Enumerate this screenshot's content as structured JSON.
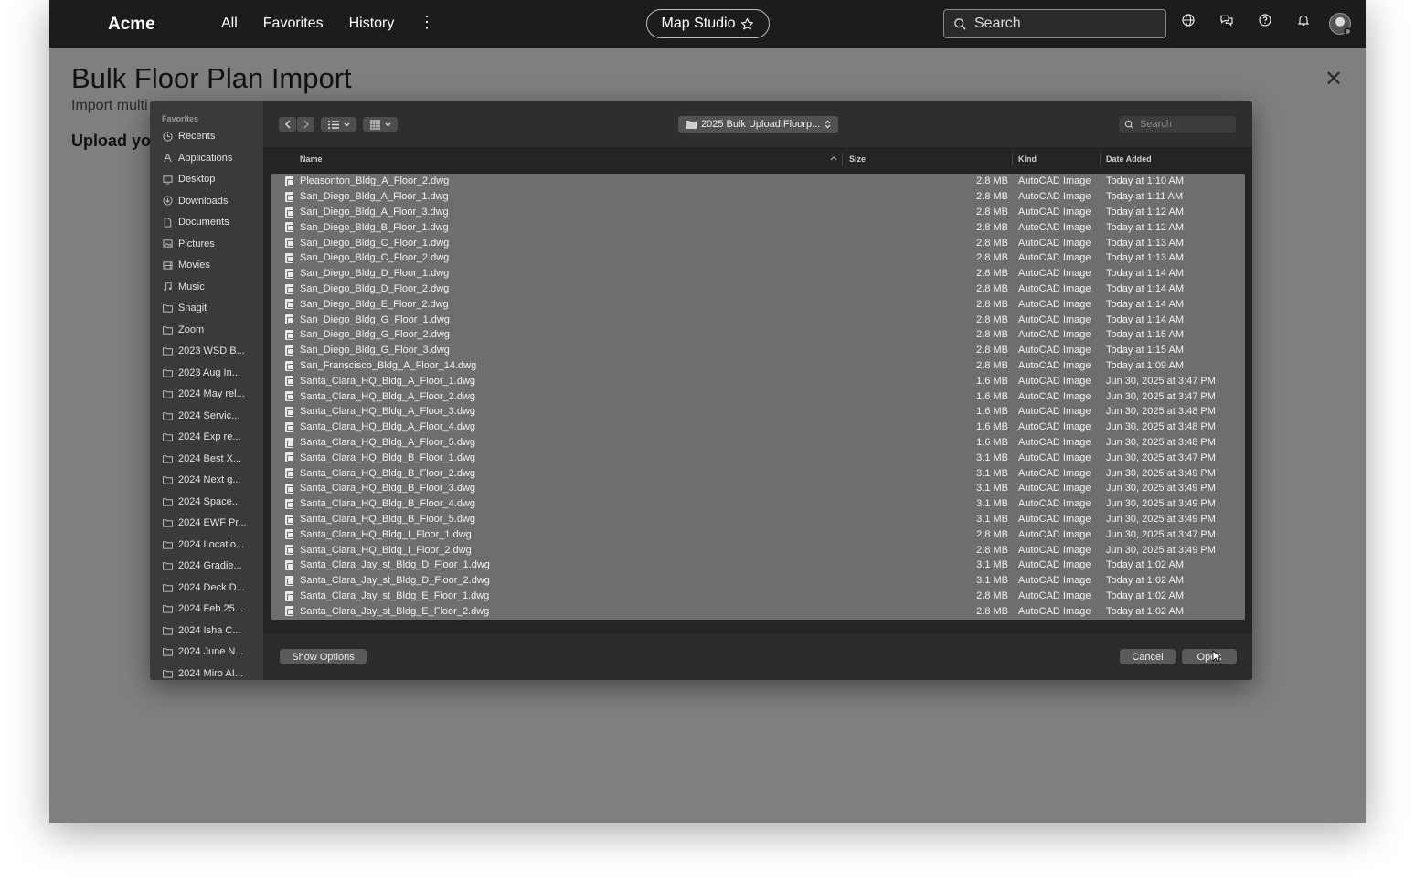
{
  "topnav": {
    "brand": "Acme",
    "links": [
      "All",
      "Favorites",
      "History"
    ],
    "workspace": "Map Studio",
    "search_placeholder": "Search"
  },
  "page": {
    "title": "Bulk Floor Plan Import",
    "subtitle": "Import multi",
    "upload_label": "Upload you"
  },
  "dialog": {
    "sidebar_section": "Favorites",
    "sidebar_items": [
      {
        "label": "Recents",
        "icon": "clock-icon"
      },
      {
        "label": "Applications",
        "icon": "applications-icon"
      },
      {
        "label": "Desktop",
        "icon": "desktop-icon"
      },
      {
        "label": "Downloads",
        "icon": "download-icon"
      },
      {
        "label": "Documents",
        "icon": "document-icon"
      },
      {
        "label": "Pictures",
        "icon": "picture-icon"
      },
      {
        "label": "Movies",
        "icon": "film-icon"
      },
      {
        "label": "Music",
        "icon": "music-icon"
      },
      {
        "label": "Snagit",
        "icon": "folder-icon"
      },
      {
        "label": "Zoom",
        "icon": "folder-icon"
      },
      {
        "label": "2023 WSD B...",
        "icon": "folder-icon"
      },
      {
        "label": "2023 Aug In...",
        "icon": "folder-icon"
      },
      {
        "label": "2024 May rel...",
        "icon": "folder-icon"
      },
      {
        "label": "2024 Servic...",
        "icon": "folder-icon"
      },
      {
        "label": "2024 Exp re...",
        "icon": "folder-icon"
      },
      {
        "label": "2024 Best X...",
        "icon": "folder-icon"
      },
      {
        "label": "2024 Next g...",
        "icon": "folder-icon"
      },
      {
        "label": "2024 Space...",
        "icon": "folder-icon"
      },
      {
        "label": "2024 EWF Pr...",
        "icon": "folder-icon"
      },
      {
        "label": "2024 Locatio...",
        "icon": "folder-icon"
      },
      {
        "label": "2024 Gradie...",
        "icon": "folder-icon"
      },
      {
        "label": "2024 Deck D...",
        "icon": "folder-icon"
      },
      {
        "label": "2024 Feb 25...",
        "icon": "folder-icon"
      },
      {
        "label": "2024 Isha C...",
        "icon": "folder-icon"
      },
      {
        "label": "2024 June N...",
        "icon": "folder-icon"
      },
      {
        "label": "2024 Miro AI...",
        "icon": "folder-icon"
      }
    ],
    "path": "2025 Bulk Upload Floorp...",
    "search_placeholder": "Search",
    "columns": {
      "name": "Name",
      "size": "Size",
      "kind": "Kind",
      "date": "Date Added"
    },
    "files": [
      {
        "name": "Pleasonton_Bldg_A_Floor_2.dwg",
        "size": "2.8 MB",
        "kind": "AutoCAD Image",
        "date": "Today at 1:10 AM"
      },
      {
        "name": "San_Diego_Bldg_A_Floor_1.dwg",
        "size": "2.8 MB",
        "kind": "AutoCAD Image",
        "date": "Today at 1:11 AM"
      },
      {
        "name": "San_Diego_Bldg_A_Floor_3.dwg",
        "size": "2.8 MB",
        "kind": "AutoCAD Image",
        "date": "Today at 1:12 AM"
      },
      {
        "name": "San_Diego_Bldg_B_Floor_1.dwg",
        "size": "2.8 MB",
        "kind": "AutoCAD Image",
        "date": "Today at 1:12 AM"
      },
      {
        "name": "San_Diego_Bldg_C_Floor_1.dwg",
        "size": "2.8 MB",
        "kind": "AutoCAD Image",
        "date": "Today at 1:13 AM"
      },
      {
        "name": "San_Diego_Bldg_C_Floor_2.dwg",
        "size": "2.8 MB",
        "kind": "AutoCAD Image",
        "date": "Today at 1:13 AM"
      },
      {
        "name": "San_Diego_Bldg_D_Floor_1.dwg",
        "size": "2.8 MB",
        "kind": "AutoCAD Image",
        "date": "Today at 1:14 AM"
      },
      {
        "name": "San_Diego_Bldg_D_Floor_2.dwg",
        "size": "2.8 MB",
        "kind": "AutoCAD Image",
        "date": "Today at 1:14 AM"
      },
      {
        "name": "San_Diego_Bldg_E_Floor_2.dwg",
        "size": "2.8 MB",
        "kind": "AutoCAD Image",
        "date": "Today at 1:14 AM"
      },
      {
        "name": "San_Diego_Bldg_G_Floor_1.dwg",
        "size": "2.8 MB",
        "kind": "AutoCAD Image",
        "date": "Today at 1:14 AM"
      },
      {
        "name": "San_Diego_Bldg_G_Floor_2.dwg",
        "size": "2.8 MB",
        "kind": "AutoCAD Image",
        "date": "Today at 1:15 AM"
      },
      {
        "name": "San_Diego_Bldg_G_Floor_3.dwg",
        "size": "2.8 MB",
        "kind": "AutoCAD Image",
        "date": "Today at 1:15 AM"
      },
      {
        "name": "San_Franscisco_Bldg_A_Floor_14.dwg",
        "size": "2.8 MB",
        "kind": "AutoCAD Image",
        "date": "Today at 1:09 AM"
      },
      {
        "name": "Santa_Clara_HQ_Bldg_A_Floor_1.dwg",
        "size": "1.6 MB",
        "kind": "AutoCAD Image",
        "date": "Jun 30, 2025 at 3:47 PM"
      },
      {
        "name": "Santa_Clara_HQ_Bldg_A_Floor_2.dwg",
        "size": "1.6 MB",
        "kind": "AutoCAD Image",
        "date": "Jun 30, 2025 at 3:47 PM"
      },
      {
        "name": "Santa_Clara_HQ_Bldg_A_Floor_3.dwg",
        "size": "1.6 MB",
        "kind": "AutoCAD Image",
        "date": "Jun 30, 2025 at 3:48 PM"
      },
      {
        "name": "Santa_Clara_HQ_Bldg_A_Floor_4.dwg",
        "size": "1.6 MB",
        "kind": "AutoCAD Image",
        "date": "Jun 30, 2025 at 3:48 PM"
      },
      {
        "name": "Santa_Clara_HQ_Bldg_A_Floor_5.dwg",
        "size": "1.6 MB",
        "kind": "AutoCAD Image",
        "date": "Jun 30, 2025 at 3:48 PM"
      },
      {
        "name": "Santa_Clara_HQ_Bldg_B_Floor_1.dwg",
        "size": "3.1 MB",
        "kind": "AutoCAD Image",
        "date": "Jun 30, 2025 at 3:47 PM"
      },
      {
        "name": "Santa_Clara_HQ_Bldg_B_Floor_2.dwg",
        "size": "3.1 MB",
        "kind": "AutoCAD Image",
        "date": "Jun 30, 2025 at 3:49 PM"
      },
      {
        "name": "Santa_Clara_HQ_Bldg_B_Floor_3.dwg",
        "size": "3.1 MB",
        "kind": "AutoCAD Image",
        "date": "Jun 30, 2025 at 3:49 PM"
      },
      {
        "name": "Santa_Clara_HQ_Bldg_B_Floor_4.dwg",
        "size": "3.1 MB",
        "kind": "AutoCAD Image",
        "date": "Jun 30, 2025 at 3:49 PM"
      },
      {
        "name": "Santa_Clara_HQ_Bldg_B_Floor_5.dwg",
        "size": "3.1 MB",
        "kind": "AutoCAD Image",
        "date": "Jun 30, 2025 at 3:49 PM"
      },
      {
        "name": "Santa_Clara_HQ_Bldg_I_Floor_1.dwg",
        "size": "2.8 MB",
        "kind": "AutoCAD Image",
        "date": "Jun 30, 2025 at 3:47 PM"
      },
      {
        "name": "Santa_Clara_HQ_Bldg_I_Floor_2.dwg",
        "size": "2.8 MB",
        "kind": "AutoCAD Image",
        "date": "Jun 30, 2025 at 3:49 PM"
      },
      {
        "name": "Santa_Clara_Jay_st_Bldg_D_Floor_1.dwg",
        "size": "3.1 MB",
        "kind": "AutoCAD Image",
        "date": "Today at 1:02 AM"
      },
      {
        "name": "Santa_Clara_Jay_st_Bldg_D_Floor_2.dwg",
        "size": "3.1 MB",
        "kind": "AutoCAD Image",
        "date": "Today at 1:02 AM"
      },
      {
        "name": "Santa_Clara_Jay_st_Bldg_E_Floor_1.dwg",
        "size": "2.8 MB",
        "kind": "AutoCAD Image",
        "date": "Today at 1:02 AM"
      },
      {
        "name": "Santa_Clara_Jay_st_Bldg_E_Floor_2.dwg",
        "size": "2.8 MB",
        "kind": "AutoCAD Image",
        "date": "Today at 1:02 AM"
      }
    ],
    "buttons": {
      "show_options": "Show Options",
      "cancel": "Cancel",
      "open": "Open"
    }
  }
}
